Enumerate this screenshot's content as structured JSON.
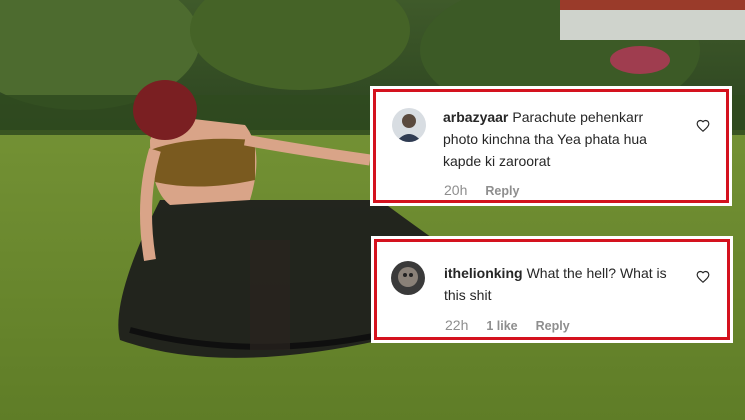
{
  "comments": [
    {
      "username": "arbazyaar",
      "text": "Parachute pehenkarr photo kinchna tha Yea phata hua kapde ki zaroorat",
      "time": "20h",
      "likes": "",
      "reply_label": "Reply",
      "avatar_icon": "user-avatar-icon",
      "like_icon": "heart-outline-icon"
    },
    {
      "username": "ithelionking",
      "text": "What the hell? What is this shit",
      "time": "22h",
      "likes": "1 like",
      "reply_label": "Reply",
      "avatar_icon": "user-avatar-icon",
      "like_icon": "heart-outline-icon"
    }
  ],
  "colors": {
    "highlight_border": "#d4121e",
    "username_text": "#262626",
    "meta_text": "#8e8e8e",
    "card_background": "#ffffff"
  }
}
